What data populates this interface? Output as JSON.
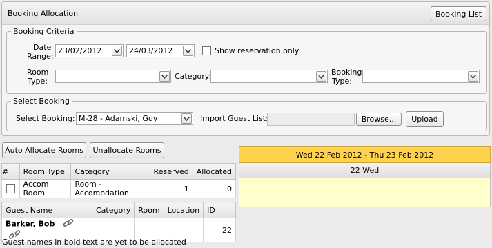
{
  "header": {
    "title": "Booking Allocation",
    "booking_list_button": "Booking List"
  },
  "criteria": {
    "legend": "Booking Criteria",
    "date_range_label_1": "Date",
    "date_range_label_2": "Range:",
    "date_from": "23/02/2012",
    "date_to": "24/03/2012",
    "show_reservation_label": "Show reservation only",
    "room_type_label_1": "Room",
    "room_type_label_2": "Type:",
    "room_type_value": "",
    "category_label": "Category:",
    "category_value": "",
    "booking_type_label_1": "Booking",
    "booking_type_label_2": "Type:",
    "booking_type_value": ""
  },
  "select_booking": {
    "legend": "Select Booking",
    "select_label": "Select Booking:",
    "selected_value": "M-28 - Adamski, Guy",
    "import_label": "Import Guest List:",
    "import_value": "",
    "browse_button": "Browse...",
    "upload_button": "Upload"
  },
  "actions": {
    "auto_allocate": "Auto Allocate Rooms",
    "unallocate": "Unallocate Rooms"
  },
  "rooms_table": {
    "headers": [
      "#",
      "Room Type",
      "Category",
      "Reserved",
      "Allocated"
    ],
    "rows": [
      {
        "room_type": "Accom Room",
        "category": "Room - Accomodation",
        "reserved": "1",
        "allocated": "0"
      }
    ]
  },
  "guests_table": {
    "headers": [
      "Guest Name",
      "Category",
      "Room",
      "Location",
      "ID"
    ],
    "rows": [
      {
        "name": "Barker, Bob",
        "category": "",
        "room": "",
        "location": "",
        "id": "22"
      }
    ]
  },
  "footer_note": "Guest names in bold text are yet to be allocated",
  "calendar": {
    "range_label": "Wed 22 Feb 2012 - Thu 23 Feb 2012",
    "day_label": "22 Wed"
  },
  "colors": {
    "calendar_header": "#ffd24d",
    "calendar_body": "#ffffcc"
  },
  "icons": {
    "dropdown": "chevron-down-icon",
    "link": "chain-link-icon",
    "unlink": "broken-chain-icon"
  }
}
